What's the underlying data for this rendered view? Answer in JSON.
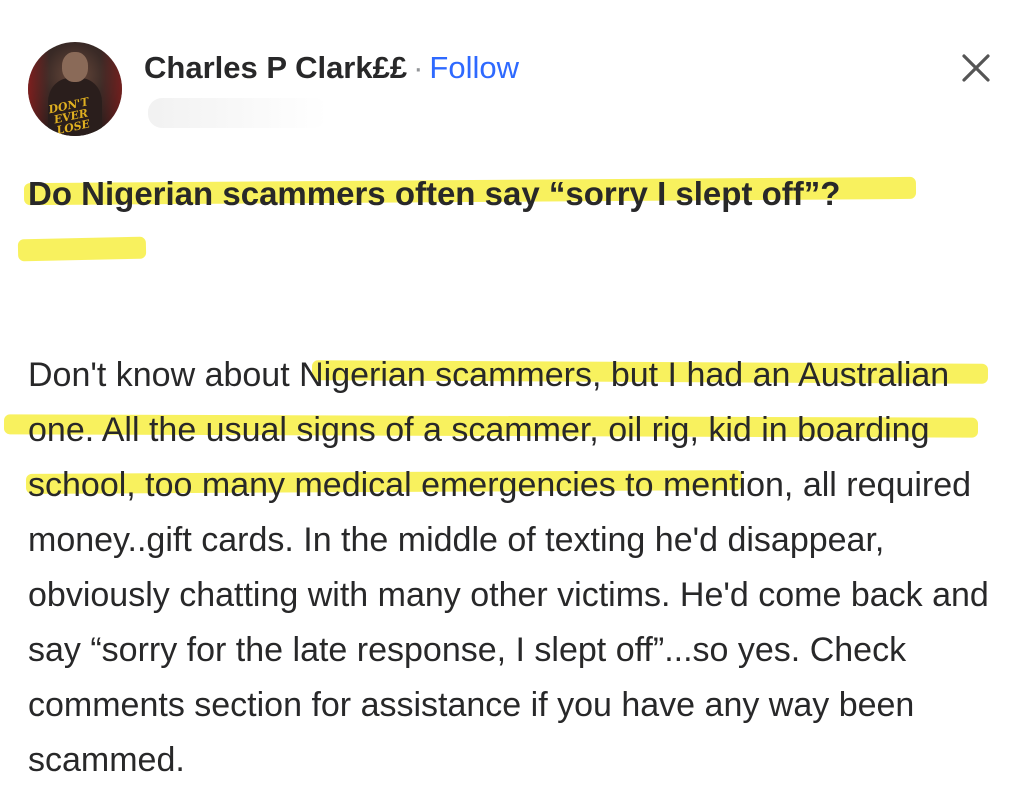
{
  "post": {
    "author_name": "Charles P Clark££",
    "separator": "·",
    "follow_label": "Follow",
    "avatar_text": "DON'T EVER LOSE",
    "question": "Do Nigerian scammers often say “sorry I slept off”?",
    "answer": "Don't know about Nigerian scammers, but I had an Australian one. All the usual signs of a scammer, oil rig, kid in boarding school, too many medical emergencies to mention, all required money..gift cards. In the middle of texting he'd disappear, obviously chatting with many other victims. He'd come back and say “sorry for the late response, I slept off”...so yes. Check comments section for assistance if you have any way been scammed."
  },
  "icons": {
    "close": "close-icon"
  },
  "colors": {
    "follow": "#2e69ff",
    "text": "#282829",
    "highlight": "#f5ec28"
  }
}
